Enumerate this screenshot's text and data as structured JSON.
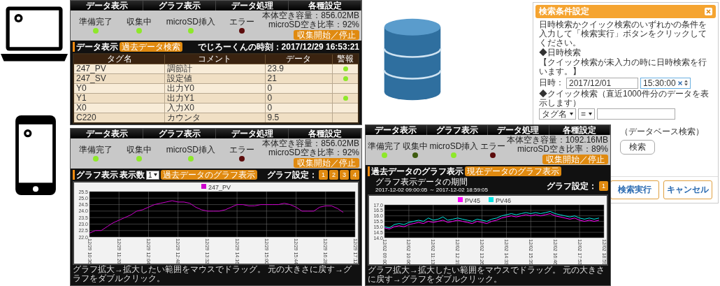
{
  "data_screen": {
    "nav": [
      "データ表示",
      "グラフ表示",
      "データ処理",
      "各種設定"
    ],
    "status": {
      "indicators": [
        {
          "label": "準備完了",
          "kind": "ok",
          "on": true
        },
        {
          "label": "収集中",
          "kind": "ok",
          "on": true
        },
        {
          "label": "microSD挿入",
          "kind": "ok",
          "on": true
        },
        {
          "label": "エラー",
          "kind": "error",
          "on": false
        }
      ],
      "storage": [
        "本体空き容量：856.02MB",
        "microSD空き比率：92%"
      ],
      "button": "収集開始／停止"
    },
    "title": "データ表示",
    "search_button": "過去データ検索",
    "clock": "でじろーくんの時刻：2017/12/29 16:53:21",
    "table": {
      "columns": [
        "タグ名",
        "コメント",
        "データ",
        "警報"
      ],
      "rows": [
        {
          "cells": [
            "247_PV",
            "調節計",
            "23.9"
          ],
          "alarm": true
        },
        {
          "cells": [
            "247_SV",
            "設定値",
            "21"
          ],
          "alarm": true
        },
        {
          "cells": [
            "Y0",
            "出力Y0",
            "0"
          ],
          "alarm": false
        },
        {
          "cells": [
            "Y1",
            "出力Y1",
            "0"
          ],
          "alarm": true
        },
        {
          "cells": [
            "X0",
            "入力X0",
            "0"
          ],
          "alarm": false
        },
        {
          "cells": [
            "C220",
            "カウンタ",
            "9.5"
          ],
          "alarm": false
        }
      ]
    }
  },
  "graph_screen": {
    "nav": [
      "データ表示",
      "グラフ表示",
      "データ処理",
      "各種設定"
    ],
    "status": {
      "indicators": [
        {
          "label": "準備完了",
          "kind": "ok",
          "on": true
        },
        {
          "label": "収集中",
          "kind": "ok",
          "on": true
        },
        {
          "label": "microSD挿入",
          "kind": "ok",
          "on": true
        },
        {
          "label": "エラー",
          "kind": "error",
          "on": false
        }
      ],
      "storage": [
        "本体空き容量：856.02MB",
        "microSD空き比率：92%"
      ],
      "button": "収集開始／停止"
    },
    "title": "グラフ表示",
    "count_label": "表示数",
    "count_select": "1",
    "history_button": "過去データのグラフ表示",
    "setting_label": "グラフ設定：",
    "setting_buttons": [
      "1",
      "2",
      "3",
      "4"
    ],
    "chart_data": {
      "type": "line",
      "grid": true,
      "legend": "top",
      "ylim": [
        22,
        25.5
      ],
      "categories": [
        "12/29 10:36",
        null,
        null,
        null,
        null,
        "12/29 11:20",
        null,
        null,
        null,
        null,
        "12/29 12:04",
        null,
        null,
        null,
        null,
        "12/29 12:48",
        null,
        null,
        null,
        null,
        "12/29 13:32",
        null,
        null,
        null,
        null,
        "12/29 14:16",
        null,
        null,
        null,
        null,
        "12/29 15:00",
        null,
        null,
        null,
        null,
        "12/29 15:44",
        null,
        null,
        null,
        null,
        "12/29 16:28",
        null,
        null,
        null,
        null,
        "12/29 17:12"
      ],
      "series": [
        {
          "name": "247_PV",
          "color": "#cc00cc",
          "values": [
            22.3,
            22.5,
            22.5,
            22.8,
            23.1,
            23.3,
            23.5,
            23.7,
            24.0,
            24.1,
            24.3,
            24.5,
            24.6,
            24.7,
            24.8,
            24.7,
            24.7,
            24.6,
            24.3,
            24.1,
            24.0,
            24.0,
            24.0,
            24.1,
            24.3,
            24.5,
            24.5,
            24.4,
            24.4,
            24.5,
            24.5,
            24.5,
            24.5,
            24.6,
            24.5,
            24.3,
            24.0,
            24.0,
            24.0,
            24.3,
            24.4,
            24.4,
            24.2,
            23.9,
            null,
            null
          ]
        }
      ],
      "yticks": [
        {
          "value": 22,
          "label": "22.0"
        },
        {
          "value": 22.5,
          "label": "22.5"
        },
        {
          "value": 23,
          "label": "23.0"
        },
        {
          "value": 23.5,
          "label": "23.5"
        },
        {
          "value": 24,
          "label": "24.0"
        },
        {
          "value": 24.5,
          "label": "24.5"
        },
        {
          "value": 25,
          "label": "25.0"
        },
        {
          "value": 25.5,
          "label": "25.5"
        }
      ]
    },
    "note": "グラフ拡大→拡大したい範囲をマウスでドラッグ。 元の大きさに戻す→グラフをダブルクリック。"
  },
  "history_screen": {
    "nav": [
      "データ表示",
      "グラフ表示",
      "データ処理",
      "各種設定"
    ],
    "status": {
      "indicators": [
        {
          "label": "準備完了",
          "kind": "ok",
          "on": true
        },
        {
          "label": "収集中",
          "kind": "ok",
          "on": false
        },
        {
          "label": "microSD挿入",
          "kind": "ok",
          "on": true
        },
        {
          "label": "エラー",
          "kind": "error",
          "on": false
        }
      ],
      "storage": [
        "本体空き容量：1092.16MB",
        "microSD空き比率：89%"
      ],
      "button": "収集開始／停止"
    },
    "title": "過去データのグラフ表示",
    "current_button": "現在データのグラフ表示",
    "setting_label": "グラフ設定：",
    "setting_buttons": [
      "1"
    ],
    "period_label": "グラフ表示データの期間",
    "period": "2017-12-02 09:00:05 ～ 2017-12-02 18:59:05",
    "chart_data": {
      "type": "line",
      "grid": true,
      "legend": "top",
      "ylim": [
        14,
        17
      ],
      "categories": [
        "12/02 09:00",
        null,
        null,
        null,
        null,
        "12/02 10:06",
        null,
        null,
        null,
        null,
        "12/02 11:13",
        null,
        null,
        null,
        null,
        "12/02 12:19",
        null,
        null,
        null,
        null,
        "12/02 13:26",
        null,
        null,
        null,
        null,
        "12/02 14:33",
        null,
        null,
        null,
        null,
        "12/02 15:39",
        null,
        null,
        null,
        null,
        "12/02 16:46",
        null,
        null,
        null,
        null,
        "12/02 17:53",
        null,
        null,
        null,
        null,
        "12/02 18:59"
      ],
      "series": [
        {
          "name": "PV45",
          "color": "#ff00ff",
          "values": [
            14.9,
            14.8,
            15.0,
            15.1,
            15.0,
            15.2,
            15.3,
            15.4,
            15.3,
            15.5,
            15.4,
            15.5,
            15.6,
            15.4,
            15.5,
            15.6,
            15.5,
            15.4,
            15.3,
            15.5,
            15.4,
            15.3,
            15.5,
            15.6,
            15.8,
            15.9,
            16.0,
            15.9,
            16.0,
            16.1,
            16.0,
            16.1,
            16.0,
            16.1,
            16.2,
            16.0,
            15.9,
            15.8,
            15.7,
            15.8,
            15.6,
            15.5,
            15.6,
            15.5,
            15.6,
            null
          ]
        },
        {
          "name": "PV46",
          "color": "#00e5e5",
          "values": [
            15.0,
            14.9,
            15.2,
            15.3,
            15.2,
            15.4,
            15.5,
            15.6,
            15.5,
            15.8,
            15.6,
            15.7,
            15.9,
            15.6,
            15.7,
            15.8,
            15.7,
            15.6,
            15.5,
            15.7,
            15.6,
            15.5,
            15.7,
            15.8,
            16.0,
            16.1,
            16.2,
            16.1,
            16.2,
            16.3,
            16.2,
            16.3,
            16.2,
            16.3,
            16.4,
            16.2,
            16.1,
            16.0,
            15.9,
            16.0,
            15.8,
            15.7,
            15.8,
            15.7,
            15.8,
            null
          ]
        }
      ],
      "yticks": [
        {
          "value": 14,
          "label": "14.0"
        },
        {
          "value": 14.5,
          "label": "14.5"
        },
        {
          "value": 15,
          "label": "15.0"
        },
        {
          "value": 15.5,
          "label": "15.5"
        },
        {
          "value": 16,
          "label": "16.0"
        },
        {
          "value": 16.5,
          "label": "16.5"
        },
        {
          "value": 17,
          "label": "17.0"
        }
      ]
    },
    "note": "グラフ拡大→拡大したい範囲をマウスでドラッグ。 元の大きさに戻す→グラフをダブルクリック。"
  },
  "search_dialog": {
    "title": "検索条件設定",
    "instruction": "日時検索かクイック検索のいずれかの条件を入力して「検索実行」ボタンをクリックしてください。",
    "datetime_heading": "◆日時検索",
    "datetime_note": "【クイック検索が未入力の時に日時検索を行います。】",
    "date_label": "日時：",
    "date": "2017/12/01",
    "time": "15:30:00",
    "quick_heading": "◆クイック検索（直近1000件分のデータを表示します）",
    "quick_field": "タグ名",
    "quick_operator": "=",
    "db_heading": "（データベース検索）",
    "db_button": "検索",
    "execute_button": "検索実行",
    "cancel_button": "キャンセル"
  }
}
